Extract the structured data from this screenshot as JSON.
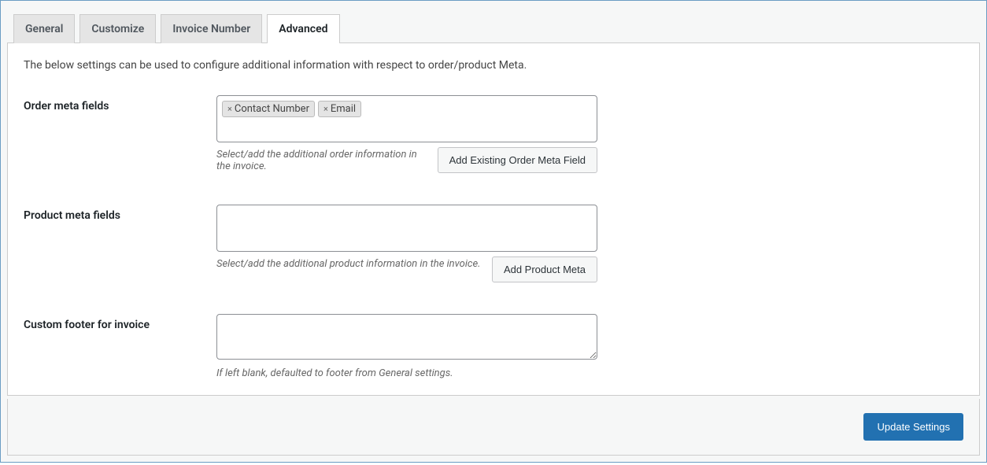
{
  "tabs": {
    "general": "General",
    "customize": "Customize",
    "invoice_number": "Invoice Number",
    "advanced": "Advanced"
  },
  "panel": {
    "intro": "The below settings can be used to configure additional information with respect to order/product Meta.",
    "order_meta": {
      "label": "Order meta fields",
      "tags": [
        "Contact Number",
        "Email"
      ],
      "help": "Select/add the additional order information in the invoice.",
      "button": "Add Existing Order Meta Field"
    },
    "product_meta": {
      "label": "Product meta fields",
      "help": "Select/add the additional product information in the invoice.",
      "button": "Add Product Meta"
    },
    "custom_footer": {
      "label": "Custom footer for invoice",
      "value": "",
      "help": "If left blank, defaulted to footer from General settings."
    }
  },
  "footer": {
    "update_button": "Update Settings"
  }
}
